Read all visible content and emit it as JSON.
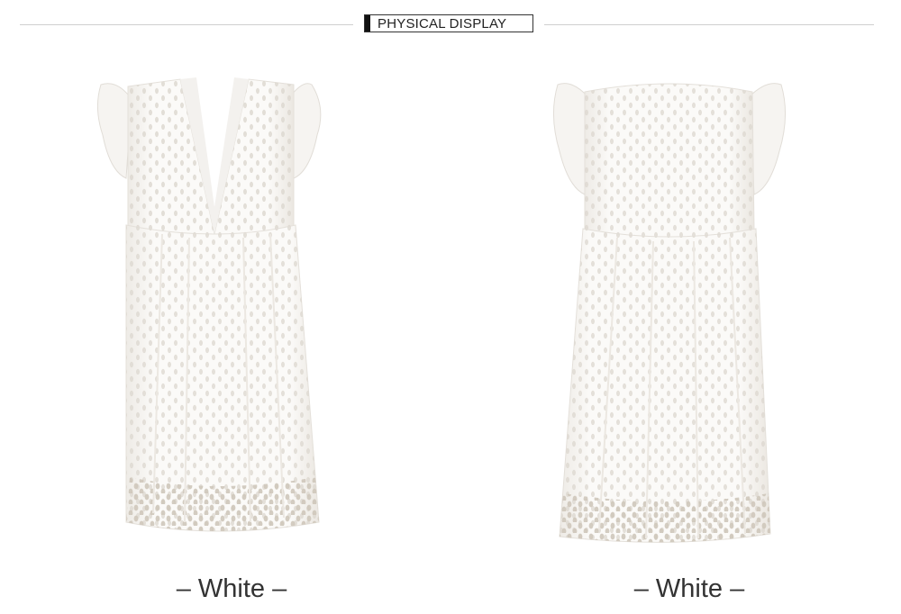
{
  "header": {
    "title": "PHYSICAL DISPLAY"
  },
  "products": [
    {
      "caption": "– White –",
      "view": "front",
      "color": "#ffffff"
    },
    {
      "caption": "– White –",
      "view": "back",
      "color": "#ffffff"
    }
  ],
  "colors": {
    "rule": "#cfcfcf",
    "text": "#333333",
    "dress_shadow": "#e9e6e1",
    "eyelet": "#d9d4cc"
  }
}
